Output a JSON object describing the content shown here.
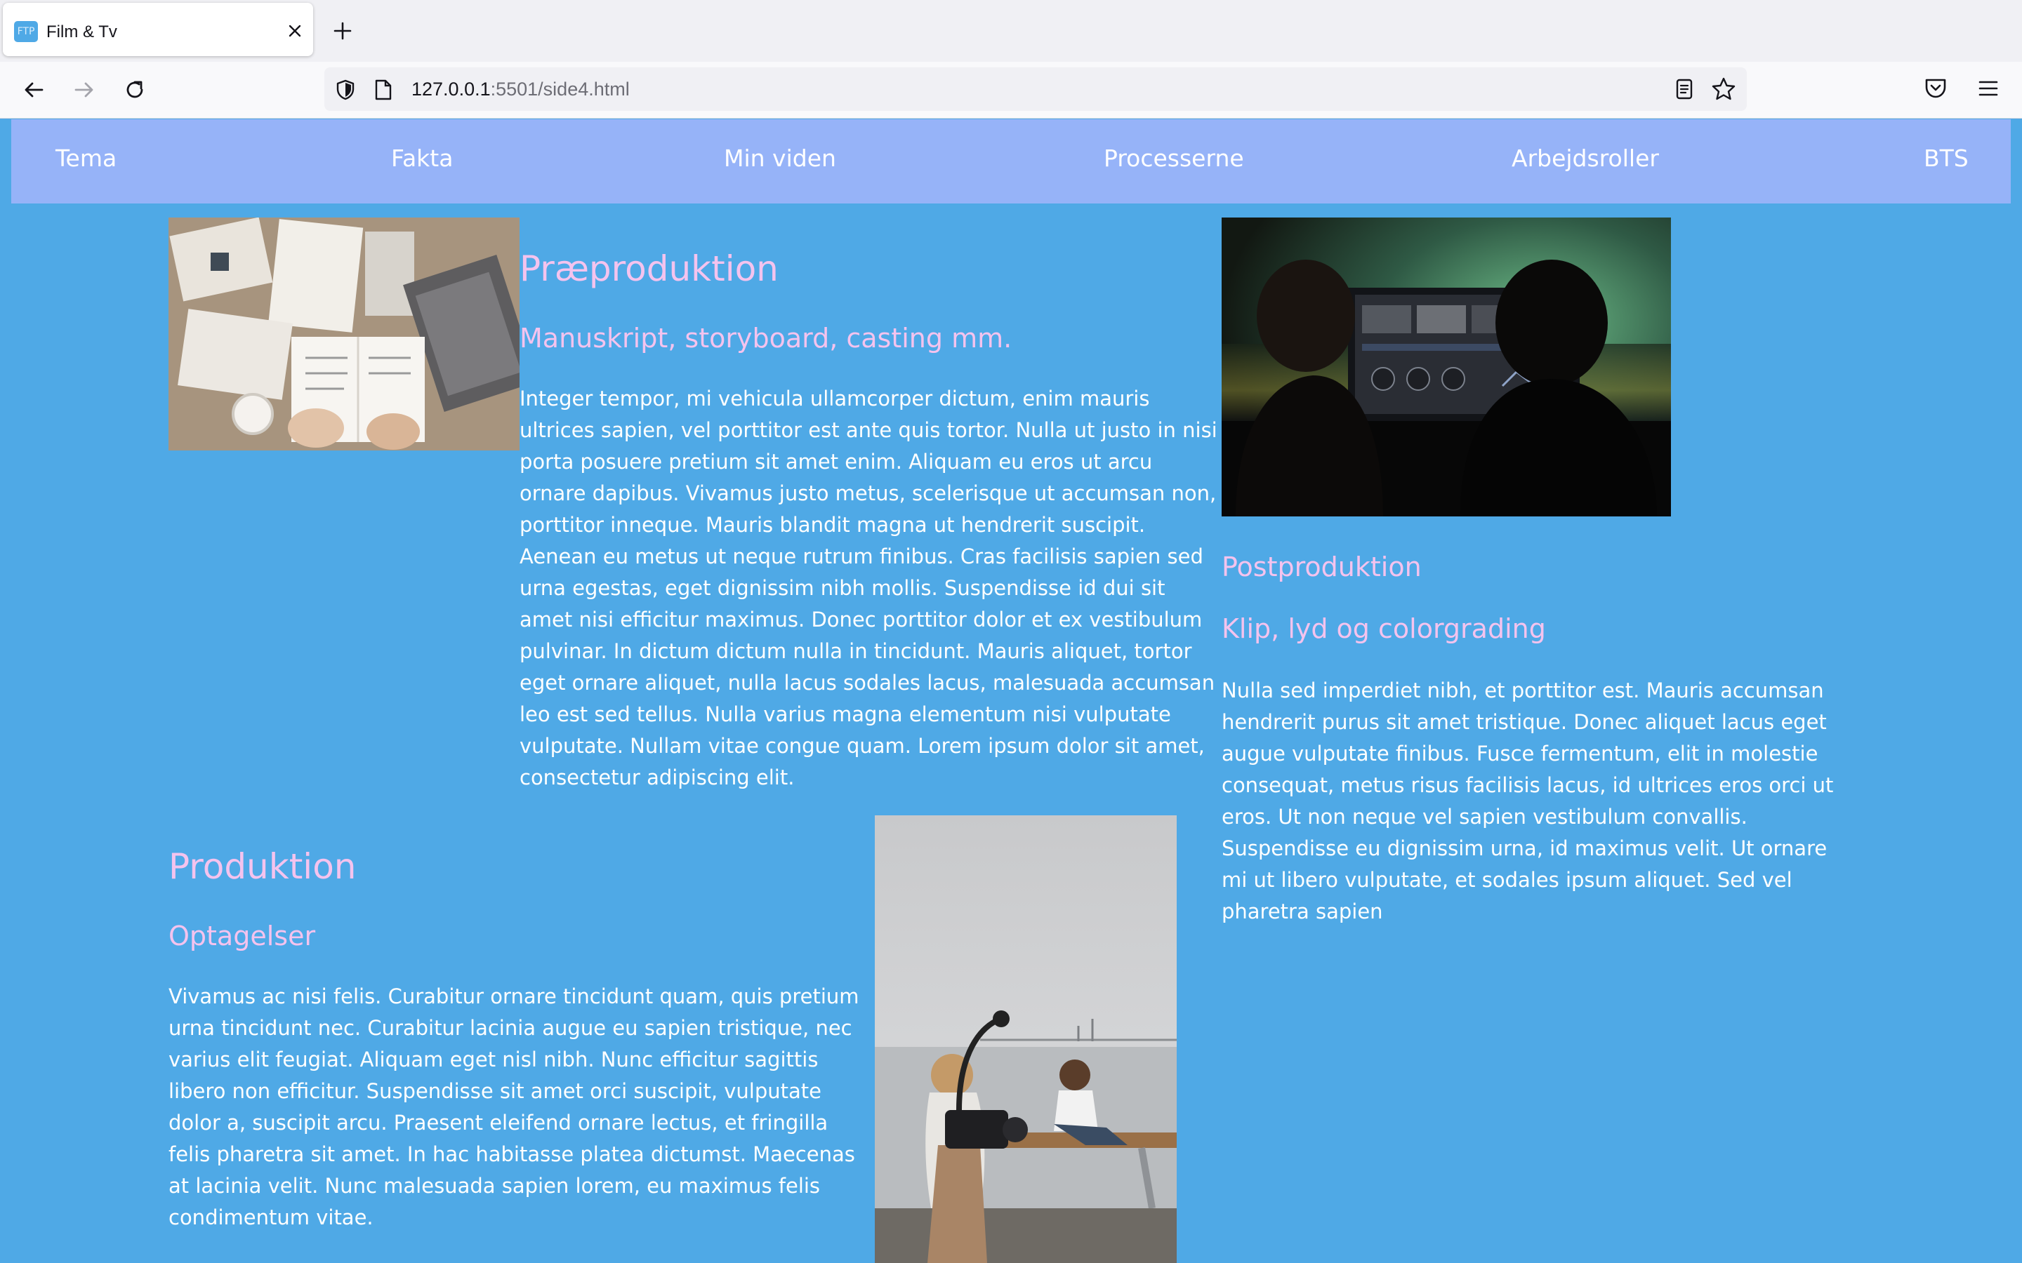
{
  "browser": {
    "tab": {
      "favicon_text": "FTP",
      "title": "Film & Tv"
    },
    "address": {
      "host": "127.0.0.1",
      "rest": ":5501/side4.html"
    }
  },
  "nav": {
    "items": [
      {
        "label": "Tema"
      },
      {
        "label": "Fakta"
      },
      {
        "label": "Min viden"
      },
      {
        "label": "Processerne"
      },
      {
        "label": "Arbejdsroller"
      },
      {
        "label": "BTS"
      }
    ]
  },
  "sections": {
    "pre": {
      "title": "Præproduktion",
      "subtitle": "Manuskript, storyboard, casting mm.",
      "text": "Integer tempor, mi vehicula ullamcorper dictum, enim mauris ultrices sapien, vel porttitor est ante quis tortor. Nulla ut justo in nisi porta posuere pretium sit amet enim. Aliquam eu eros ut arcu ornare dapibus. Vivamus justo metus, scelerisque ut accumsan non, porttitor inneque. Mauris blandit magna ut hendrerit suscipit. Aenean eu metus ut neque rutrum finibus. Cras facilisis sapien sed urna egestas, eget dignissim nibh mollis. Suspendisse id dui sit amet nisi efficitur maximus. Donec porttitor dolor et ex vestibulum pulvinar. In dictum dictum nulla in tincidunt. Mauris aliquet, tortor eget ornare aliquet, nulla lacus sodales lacus, malesuada accumsan leo est sed tellus. Nulla varius magna elementum nisi vulputate vulputate. Nullam vitae congue quam. Lorem ipsum dolor sit amet, consectetur adipiscing elit."
    },
    "post": {
      "title": "Postproduktion",
      "subtitle": "Klip, lyd og colorgrading",
      "text": "Nulla sed imperdiet nibh, et porttitor est. Mauris accumsan hendrerit purus sit amet tristique. Donec aliquet lacus eget augue vulputate finibus. Fusce fermentum, elit in molestie consequat, metus risus facilisis lacus, id ultrices eros orci ut eros. Ut non neque vel sapien vestibulum convallis. Suspendisse eu dignissim urna, id maximus velit. Ut ornare mi ut libero vulputate, et sodales ipsum aliquet. Sed vel pharetra sapien"
    },
    "prod": {
      "title": "Produktion",
      "subtitle": "Optagelser",
      "text": "Vivamus ac nisi felis. Curabitur ornare tincidunt quam, quis pretium urna tincidunt nec. Curabitur lacinia augue eu sapien tristique, nec varius elit feugiat. Aliquam eget nisl nibh. Nunc efficitur sagittis libero non efficitur. Suspendisse sit amet orci suscipit, vulputate dolor a, suscipit arcu. Praesent eleifend ornare lectus, et fringilla felis pharetra sit amet. In hac habitasse platea dictumst. Maecenas at lacinia velit. Nunc malesuada sapien lorem, eu maximus felis condimentum vitae."
    }
  }
}
